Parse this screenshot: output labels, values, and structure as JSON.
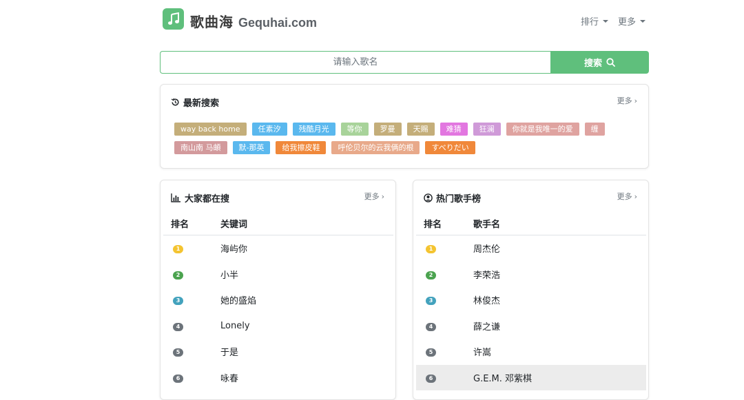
{
  "header": {
    "logo_cn": "歌曲海",
    "logo_en": "Gequhai.com",
    "nav": [
      {
        "label": "排行"
      },
      {
        "label": "更多"
      }
    ]
  },
  "search": {
    "placeholder": "请输入歌名",
    "button_label": "搜索"
  },
  "recent": {
    "title": "最新搜索",
    "more": "更多",
    "tags": [
      {
        "label": "way back home",
        "color": "#c4ae7a"
      },
      {
        "label": "任素汐",
        "color": "#5ab8ee"
      },
      {
        "label": "残酷月光",
        "color": "#5ab8ee"
      },
      {
        "label": "等你",
        "color": "#a8d39a"
      },
      {
        "label": "罗曼",
        "color": "#c4ae7a"
      },
      {
        "label": "天赐",
        "color": "#c4ae7a"
      },
      {
        "label": "难猜",
        "color": "#e277e0"
      },
      {
        "label": "狂澜",
        "color": "#cf9ad8"
      },
      {
        "label": "你就是我唯一的爱",
        "color": "#dfa3a0"
      },
      {
        "label": "缠",
        "color": "#dfa3a0"
      },
      {
        "label": "南山南 马頔",
        "color": "#d39a9c"
      },
      {
        "label": "默-那英",
        "color": "#5ab8ee"
      },
      {
        "label": "给我擦皮鞋",
        "color": "#f0883a"
      },
      {
        "label": "呼伦贝尔的云我俩的根",
        "color": "#e8a98a"
      },
      {
        "label": "すべりだい",
        "color": "#f0883a"
      }
    ]
  },
  "hot_search": {
    "title": "大家都在搜",
    "more": "更多",
    "col_rank": "排名",
    "col_name": "关键词",
    "rows": [
      {
        "rank": "1",
        "name": "海屿你",
        "color": "#f4c431"
      },
      {
        "rank": "2",
        "name": "小半",
        "color": "#4ba34f"
      },
      {
        "rank": "3",
        "name": "她的盛焰",
        "color": "#43a2bd"
      },
      {
        "rank": "4",
        "name": "Lonely",
        "color": "#6c737a"
      },
      {
        "rank": "5",
        "name": "于是",
        "color": "#6c737a"
      },
      {
        "rank": "6",
        "name": "咏春",
        "color": "#6c737a"
      }
    ]
  },
  "hot_singers": {
    "title": "热门歌手榜",
    "more": "更多",
    "col_rank": "排名",
    "col_name": "歌手名",
    "rows": [
      {
        "rank": "1",
        "name": "周杰伦",
        "color": "#f4c431"
      },
      {
        "rank": "2",
        "name": "李荣浩",
        "color": "#4ba34f"
      },
      {
        "rank": "3",
        "name": "林俊杰",
        "color": "#43a2bd"
      },
      {
        "rank": "4",
        "name": "薛之谦",
        "color": "#6c737a"
      },
      {
        "rank": "5",
        "name": "许嵩",
        "color": "#6c737a"
      },
      {
        "rank": "6",
        "name": "G.E.M. 邓紫棋",
        "color": "#6c737a"
      }
    ]
  },
  "theme": {
    "accent": "#5fbf7c"
  }
}
